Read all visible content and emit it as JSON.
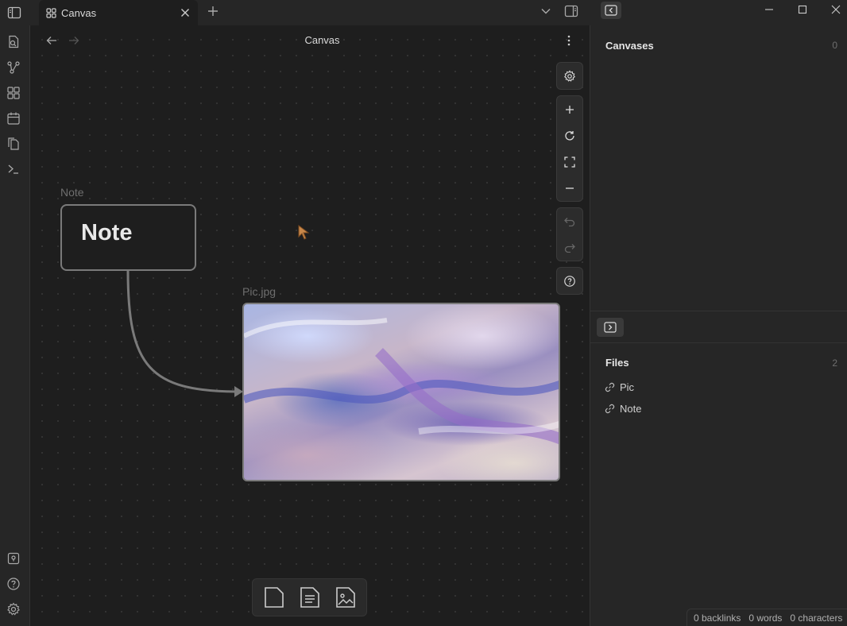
{
  "tab": {
    "label": "Canvas"
  },
  "view": {
    "title": "Canvas"
  },
  "canvas": {
    "note": {
      "label": "Note",
      "heading": "Note"
    },
    "image": {
      "label": "Pic.jpg"
    }
  },
  "right_sidebar": {
    "canvases": {
      "title": "Canvases",
      "count": "0"
    },
    "files": {
      "title": "Files",
      "count": "2",
      "items": [
        {
          "label": "Pic"
        },
        {
          "label": "Note"
        }
      ]
    }
  },
  "status": {
    "backlinks": "0 backlinks",
    "words": "0 words",
    "characters": "0 characters"
  },
  "colors": {
    "background": "#1e1e1e",
    "sidebar": "#262626",
    "border": "#7a7a7a"
  }
}
